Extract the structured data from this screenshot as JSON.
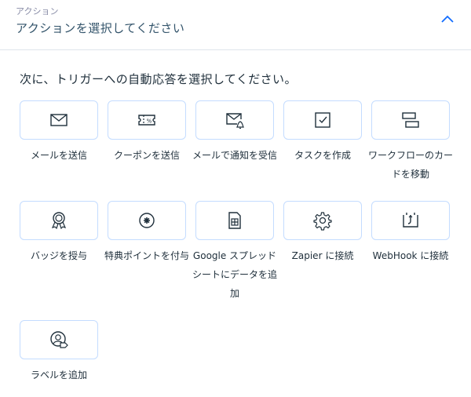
{
  "header": {
    "label": "アクション",
    "value": "アクションを選択してください"
  },
  "prompt": "次に、トリガーへの自動応答を選択してください。",
  "actions": [
    {
      "label": "メールを送信",
      "icon": "mail-icon"
    },
    {
      "label": "クーポンを送信",
      "icon": "coupon-icon"
    },
    {
      "label": "メールで通知を受信",
      "icon": "mail-notification-icon"
    },
    {
      "label": "タスクを作成",
      "icon": "task-checkbox-icon"
    },
    {
      "label": "ワークフローのカードを移動",
      "icon": "workflow-card-icon"
    },
    {
      "label": "バッジを授与",
      "icon": "badge-award-icon"
    },
    {
      "label": "特典ポイントを付与",
      "icon": "loyalty-points-icon"
    },
    {
      "label": "Google スプレッドシートにデータを追加",
      "icon": "spreadsheet-icon"
    },
    {
      "label": "Zapier に接続",
      "icon": "gear-icon"
    },
    {
      "label": "WebHook に接続",
      "icon": "webhook-icon"
    },
    {
      "label": "ラベルを追加",
      "icon": "label-contact-icon"
    }
  ],
  "colors": {
    "card_border": "#c4dcff",
    "accent": "#116dff",
    "text": "#20303c"
  }
}
